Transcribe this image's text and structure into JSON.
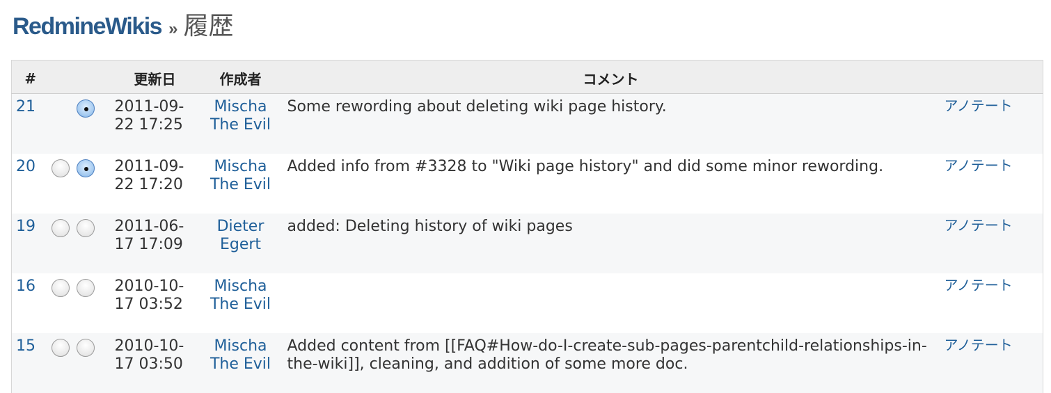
{
  "title": {
    "wiki": "RedmineWikis",
    "separator": "»",
    "page": "履歴"
  },
  "table": {
    "headers": {
      "num": "#",
      "date": "更新日",
      "author": "作成者",
      "comment": "コメント"
    },
    "rows": [
      {
        "num": "21",
        "date": "2011-09-22 17:25",
        "author": "Mischa The Evil",
        "comment": "Some rewording about deleting wiki page history.",
        "annotate": "アノテート",
        "radio_from": null,
        "radio_to": true
      },
      {
        "num": "20",
        "date": "2011-09-22 17:20",
        "author": "Mischa The Evil",
        "comment": "Added info from #3328 to \"Wiki page history\" and did some minor rewording.",
        "annotate": "アノテート",
        "radio_from": false,
        "radio_to": true
      },
      {
        "num": "19",
        "date": "2011-06-17 17:09",
        "author": "Dieter Egert",
        "comment": "added: Deleting history of wiki pages",
        "annotate": "アノテート",
        "radio_from": false,
        "radio_to": false
      },
      {
        "num": "16",
        "date": "2010-10-17 03:52",
        "author": "Mischa The Evil",
        "comment": "",
        "annotate": "アノテート",
        "radio_from": false,
        "radio_to": false
      },
      {
        "num": "15",
        "date": "2010-10-17 03:50",
        "author": "Mischa The Evil",
        "comment": "Added content from [[FAQ#How-do-I-create-sub-pages-parentchild-relationships-in-the-wiki]], cleaning, and addition of some more doc.",
        "annotate": "アノテート",
        "radio_from": false,
        "radio_to": false
      }
    ]
  }
}
